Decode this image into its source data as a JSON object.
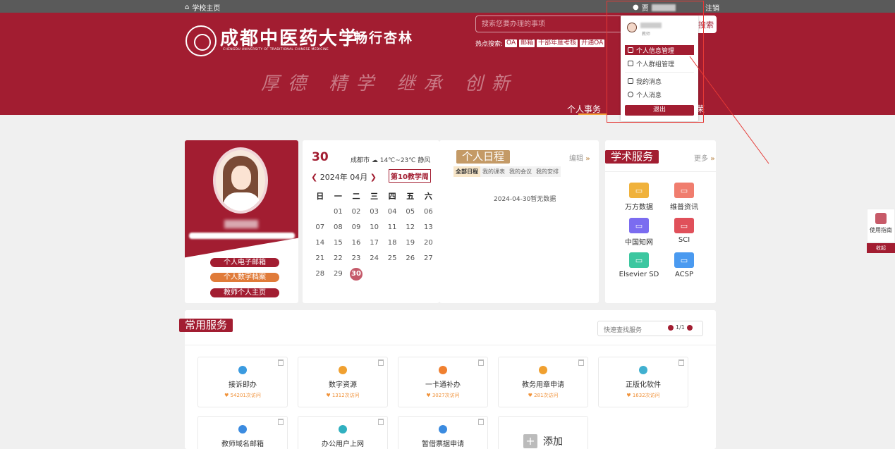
{
  "topbar": {
    "home_label": "学校主页",
    "logout_label": "注销",
    "user_prefix": "贾"
  },
  "banner": {
    "school_name": "成都中医药大学",
    "school_name_en": "CHENGDU UNIVERSITY OF TRADITIONAL CHINESE MEDICINE",
    "portal_name": "畅行杏林",
    "motto": "厚德 精学 继承 创新"
  },
  "search": {
    "placeholder": "搜索您要办理的事项",
    "button_label": "搜索"
  },
  "hot": {
    "label": "热点搜索:",
    "tags": [
      "OA",
      "邮箱",
      "干部年度考核",
      "开通OA"
    ]
  },
  "nav": {
    "personal": "个人事务",
    "other": "荣"
  },
  "dropdown": {
    "role": "教师",
    "items": [
      "个人信息管理",
      "个人群组管理",
      "我的消息",
      "个人消息"
    ],
    "logout": "退出"
  },
  "profile": {
    "buttons": [
      "个人电子邮箱",
      "个人数字档案",
      "教师个人主页"
    ],
    "colors": [
      "#a21d31",
      "#e07b39",
      "#a21d31"
    ]
  },
  "calendar": {
    "day": "30",
    "weather": "成都市 ☁ 14℃~23℃ 静风",
    "month": "2024年 04月",
    "week": "第10教学周",
    "headers": [
      "日",
      "一",
      "二",
      "三",
      "四",
      "五",
      "六"
    ],
    "rows": [
      [
        "",
        "01",
        "02",
        "03",
        "04",
        "05",
        "06"
      ],
      [
        "07",
        "08",
        "09",
        "10",
        "11",
        "12",
        "13"
      ],
      [
        "14",
        "15",
        "16",
        "17",
        "18",
        "19",
        "20"
      ],
      [
        "21",
        "22",
        "23",
        "24",
        "25",
        "26",
        "27"
      ],
      [
        "28",
        "29",
        "30",
        "",
        "",
        "",
        ""
      ]
    ],
    "today": "30"
  },
  "schedule": {
    "title": "个人日程",
    "edit": "编辑",
    "tabs": [
      "全部日程",
      "我的课表",
      "我的会议",
      "我的安排"
    ],
    "empty": "2024-04-30暂无数据"
  },
  "academic": {
    "title": "学术服务",
    "more": "更多",
    "items": [
      {
        "name": "万方数据",
        "color": "#f0b23c",
        "icon": "document-icon"
      },
      {
        "name": "维普资讯",
        "color": "#f07d6e",
        "icon": "mail-icon"
      },
      {
        "name": "中国知网",
        "color": "#7b6cf0",
        "icon": "screen-icon"
      },
      {
        "name": "SCI",
        "color": "#e0505a",
        "icon": "chat-icon"
      },
      {
        "name": "Elsevier SD",
        "color": "#3cc7a0",
        "icon": "file-search-icon"
      },
      {
        "name": "ACSP",
        "color": "#4a9af0",
        "icon": "layers-icon"
      }
    ]
  },
  "services": {
    "title": "常用服务",
    "quick_placeholder": "快速查找服务",
    "page": "1/1",
    "tiles": [
      {
        "title": "接诉即办",
        "visits": "54201次访问",
        "color": "#3b9be0"
      },
      {
        "title": "数字资源",
        "visits": "1312次访问",
        "color": "#f0a030"
      },
      {
        "title": "一卡通补办",
        "visits": "3027次访问",
        "color": "#f08030"
      },
      {
        "title": "教务用章申请",
        "visits": "281次访问",
        "color": "#f0a030"
      },
      {
        "title": "正版化软件",
        "visits": "1632次访问",
        "color": "#40b0d0"
      },
      {
        "title": "教师域名邮箱",
        "visits": "",
        "color": "#3b8be0"
      },
      {
        "title": "办公用户上网",
        "visits": "",
        "color": "#30b0c0"
      },
      {
        "title": "暂借票据申请",
        "visits": "",
        "color": "#3b8be0"
      }
    ],
    "add_label": "添加"
  },
  "side": {
    "guide": "使用指南",
    "collapse": "收起"
  }
}
